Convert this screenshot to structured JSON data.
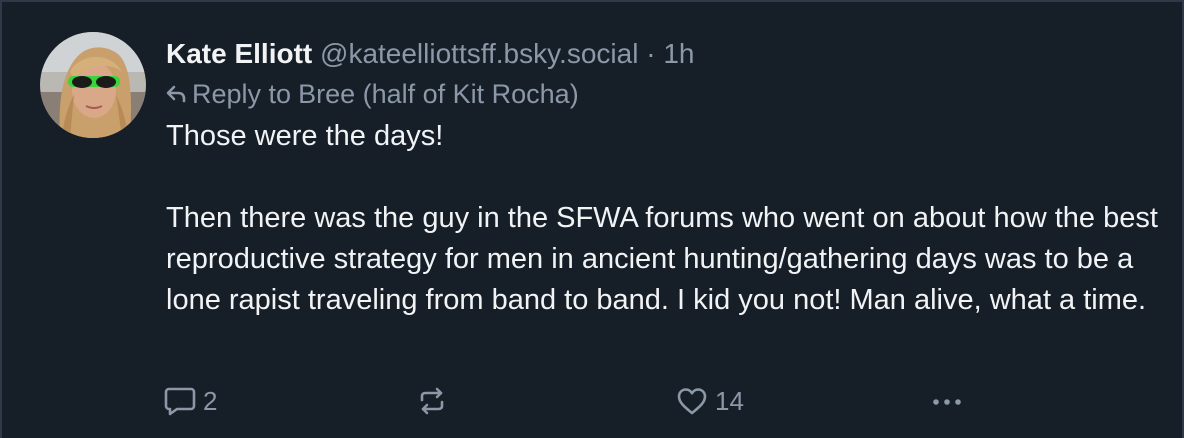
{
  "post": {
    "author": {
      "display_name": "Kate Elliott",
      "handle": "@kateelliottsff.bsky.social",
      "avatar_icon": "user-avatar-photo"
    },
    "separator": "·",
    "time": "1h",
    "reply_to": {
      "icon": "reply-arrow-icon",
      "prefix": "Reply to",
      "name": "Bree (half of Kit Rocha)"
    },
    "body": {
      "line1": "Those were the days!",
      "line2": "Then there was the guy in the SFWA forums who went on about how the best reproductive strategy for men in ancient hunting/gathering days was to be a lone rapist traveling from band to band. I kid you not! Man alive, what a time."
    },
    "actions": {
      "reply": {
        "icon": "comment-icon",
        "count": "2"
      },
      "repost": {
        "icon": "repost-icon"
      },
      "like": {
        "icon": "heart-icon",
        "count": "14"
      },
      "more": {
        "icon": "more-dots-icon"
      }
    },
    "colors": {
      "background": "#161e27",
      "text_primary": "#f1f3f5",
      "text_secondary": "#8b98a8",
      "border": "#2e3a48"
    }
  }
}
